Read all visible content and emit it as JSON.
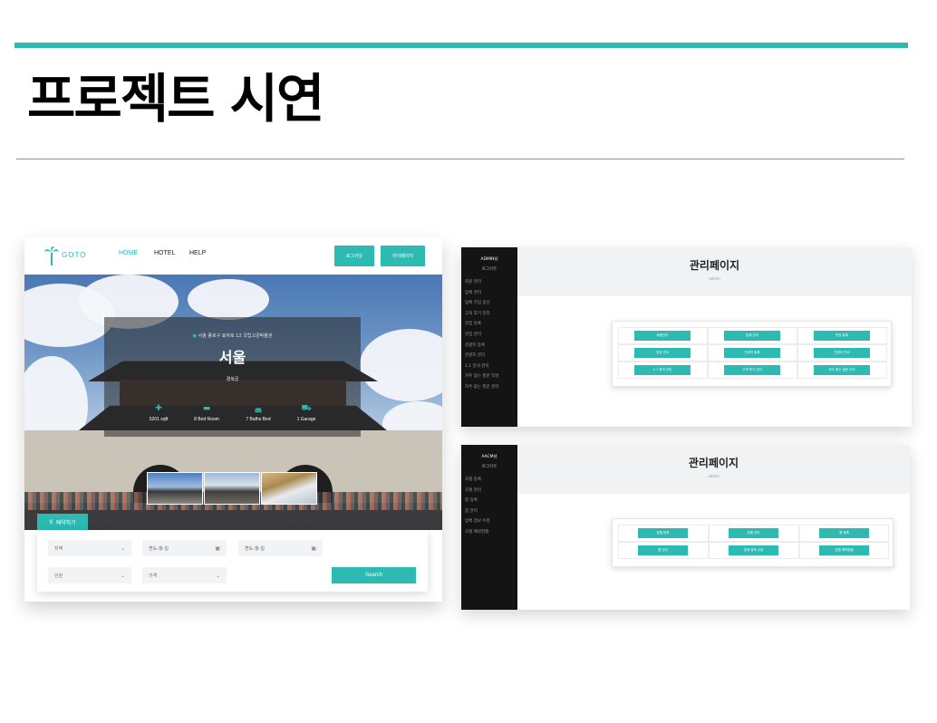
{
  "slide": {
    "title": "프로젝트 시연"
  },
  "colors": {
    "accent": "#2cbab3",
    "sidebar": "#141414"
  },
  "user_page": {
    "logo": "GOTO",
    "nav": [
      "HOME",
      "HOTEL",
      "HELP"
    ],
    "buttons": {
      "logout": "로그아웃",
      "mypage": "마이페이지"
    },
    "hero": {
      "address": "서울 종로구 효자로 12 국립고궁박물관",
      "city": "서울",
      "district": "경복궁",
      "stats": [
        {
          "icon": "plus-icon",
          "label": "5201 sqft"
        },
        {
          "icon": "bed-icon",
          "label": "8 Bed Room"
        },
        {
          "icon": "bath-icon",
          "label": "7 Baths Bed"
        },
        {
          "icon": "car-icon",
          "label": "1 Garage"
        }
      ]
    },
    "search": {
      "tab_label": "예약하기",
      "region": "지역",
      "checkin": "연도-월-일",
      "checkout": "연도-월-일",
      "guests": "인원",
      "price": "가격",
      "button": "Search"
    }
  },
  "admin_page": {
    "user": "ADMIN님",
    "logout": "로그아웃",
    "menu": [
      "회원 관리",
      "업체 관리",
      "업체 가입 승인",
      "고객 후기 관리",
      "맛집 등록",
      "맛집 관리",
      "관광지 등록",
      "관광지 관리",
      "1:1 문의 관리",
      "자주 묻는 질문 작성",
      "자주 묻는 질문 관리"
    ],
    "title": "관리페이지",
    "subtitle": "admin",
    "buttons": [
      "회원관리",
      "업체 관리",
      "맛집 등록",
      "맛집 관리",
      "관광지 등록",
      "관광지 관리",
      "1:1 문의 관리",
      "고객 후기 관리",
      "자주 묻는 질문 관리"
    ]
  },
  "partner_page": {
    "user": "AACM님",
    "logout": "로그아웃",
    "menu": [
      "호텔 등록",
      "호텔 관리",
      "룸 등록",
      "룸 관리",
      "업체 정보 수정",
      "호텔 예약현황"
    ],
    "title": "관리페이지",
    "subtitle": "admin",
    "buttons": [
      "호텔 등록",
      "호텔 관리",
      "룸 등록",
      "룸 관리",
      "업체 정보 수정",
      "호텔 예약현황"
    ]
  }
}
